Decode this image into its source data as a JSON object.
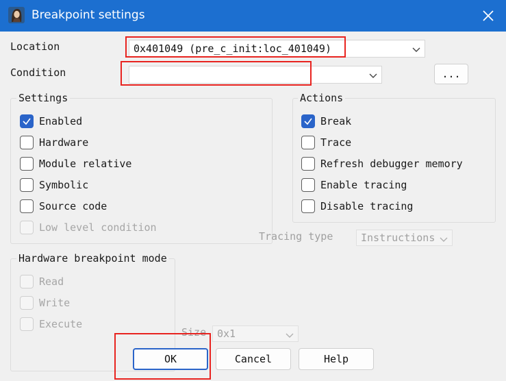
{
  "window": {
    "title": "Breakpoint settings",
    "icon": "app-portrait-icon",
    "close_icon": "close-icon"
  },
  "location": {
    "label": "Location",
    "value": "0x401049 (pre_c_init:loc_401049)"
  },
  "condition": {
    "label": "Condition",
    "value": "",
    "ellipsis_button": "..."
  },
  "settings": {
    "title": "Settings",
    "items": [
      {
        "label": "Enabled",
        "checked": true,
        "enabled": true
      },
      {
        "label": "Hardware",
        "checked": false,
        "enabled": true
      },
      {
        "label": "Module relative",
        "checked": false,
        "enabled": true
      },
      {
        "label": "Symbolic",
        "checked": false,
        "enabled": true
      },
      {
        "label": "Source code",
        "checked": false,
        "enabled": true
      },
      {
        "label": "Low level condition",
        "checked": false,
        "enabled": false
      }
    ]
  },
  "actions": {
    "title": "Actions",
    "items": [
      {
        "label": "Break",
        "checked": true
      },
      {
        "label": "Trace",
        "checked": false
      },
      {
        "label": "Refresh debugger memory",
        "checked": false
      },
      {
        "label": "Enable tracing",
        "checked": false
      },
      {
        "label": "Disable tracing",
        "checked": false
      }
    ]
  },
  "tracing_type": {
    "label": "Tracing type",
    "value": "Instructions"
  },
  "hw_mode": {
    "title": "Hardware breakpoint mode",
    "items": [
      {
        "label": "Read"
      },
      {
        "label": "Write"
      },
      {
        "label": "Execute"
      }
    ]
  },
  "size": {
    "label": "Size",
    "value": "0x1"
  },
  "buttons": {
    "ok": "OK",
    "cancel": "Cancel",
    "help": "Help"
  },
  "colors": {
    "accent": "#2a64c9",
    "titlebar": "#1c6fd0",
    "highlight": "#e8231f"
  }
}
